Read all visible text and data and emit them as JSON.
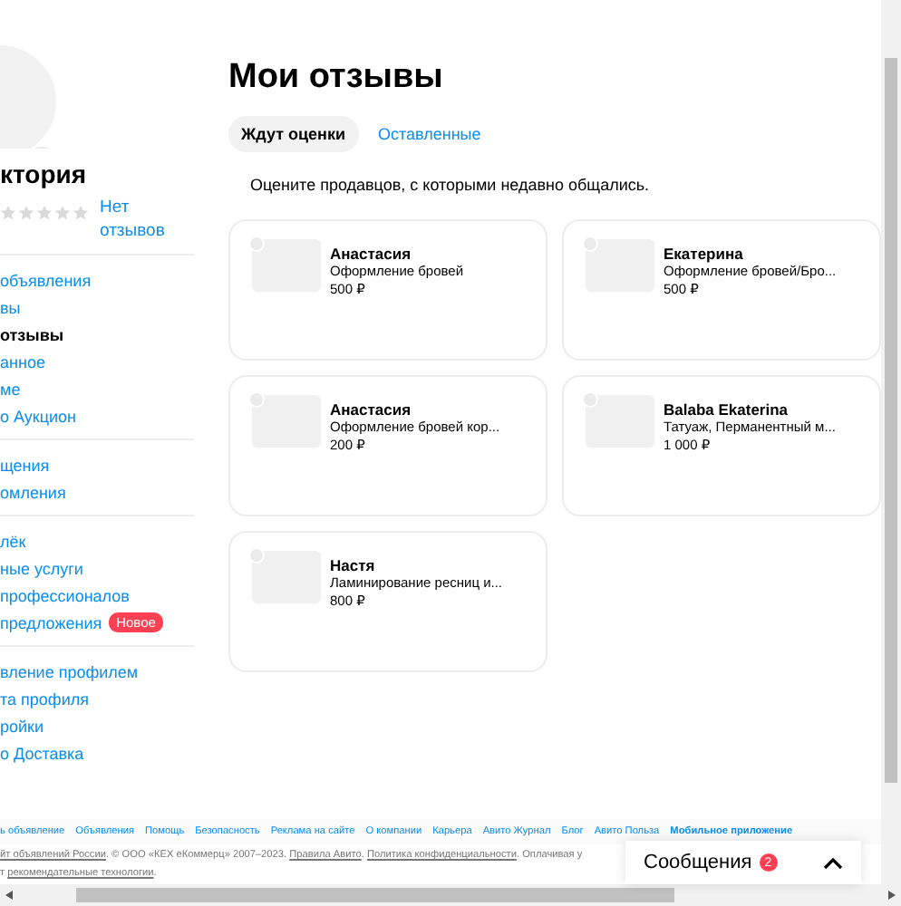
{
  "profile": {
    "name": "ктория",
    "stars": 0,
    "reviews_link": "Нет отзывов"
  },
  "nav_groups": [
    [
      {
        "label": "объявления",
        "selected": false
      },
      {
        "label": "вы",
        "selected": false
      },
      {
        "label": "отзывы",
        "selected": true
      },
      {
        "label": "анное",
        "selected": false
      },
      {
        "label": "ме",
        "selected": false
      },
      {
        "label": "о Аукцион",
        "selected": false
      }
    ],
    [
      {
        "label": "щения",
        "selected": false
      },
      {
        "label": "омления",
        "selected": false
      }
    ],
    [
      {
        "label": "лёк",
        "selected": false
      },
      {
        "label": "ные услуги",
        "selected": false
      },
      {
        "label": "профессионалов",
        "selected": false
      },
      {
        "label": "предложения",
        "selected": false,
        "badge": "Новое"
      }
    ],
    [
      {
        "label": "вление профилем",
        "selected": false
      },
      {
        "label": "та профиля",
        "selected": false
      },
      {
        "label": "ройки",
        "selected": false
      },
      {
        "label": "о Доставка",
        "selected": false
      }
    ]
  ],
  "page": {
    "title": "Мои отзывы",
    "tabs": [
      {
        "label": "Ждут оценки",
        "selected": true
      },
      {
        "label": "Оставленные",
        "selected": false
      }
    ],
    "hint": "Оцените продавцов, с которыми недавно общались.",
    "cards": [
      {
        "name": "Анастасия",
        "service": "Оформление бровей",
        "price": "500 ₽"
      },
      {
        "name": "Екатерина",
        "service": "Оформление бровей/Бро...",
        "price": "500 ₽"
      },
      {
        "name": "Анастасия",
        "service": "Оформление бровей кор...",
        "price": "200 ₽"
      },
      {
        "name": "Balaba Ekaterina",
        "service": "Татуаж, Перманентный м...",
        "price": "1 000 ₽"
      },
      {
        "name": "Настя",
        "service": "Ламинирование ресниц и...",
        "price": "800 ₽"
      }
    ]
  },
  "footer": {
    "links": [
      {
        "label": "ь объявление",
        "emphasized": false
      },
      {
        "label": "Объявления",
        "emphasized": false
      },
      {
        "label": "Помощь",
        "emphasized": false
      },
      {
        "label": "Безопасность",
        "emphasized": false
      },
      {
        "label": "Реклама на сайте",
        "emphasized": false
      },
      {
        "label": "О компании",
        "emphasized": false
      },
      {
        "label": "Карьера",
        "emphasized": false
      },
      {
        "label": "Авито Журнал",
        "emphasized": false
      },
      {
        "label": "Блог",
        "emphasized": false
      },
      {
        "label": "Авито Польза",
        "emphasized": false
      },
      {
        "label": "Мобильное приложение",
        "emphasized": true
      }
    ],
    "legal": [
      [
        {
          "text": "йт объявлений России",
          "link": true
        },
        {
          "text": ". © ООО «КЕХ еКоммерц» 2007–2023. ",
          "link": false
        },
        {
          "text": "Правила Авито",
          "link": true
        },
        {
          "text": ". ",
          "link": false
        },
        {
          "text": "Политика конфиденциальности",
          "link": true
        },
        {
          "text": ". Оплачивая у",
          "link": false
        }
      ],
      [
        {
          "text": "т ",
          "link": false
        },
        {
          "text": "рекомендательные технологии",
          "link": true
        },
        {
          "text": ".",
          "link": false
        }
      ]
    ]
  },
  "messages": {
    "label": "Сообщения",
    "count": "2",
    "expanded": false
  }
}
